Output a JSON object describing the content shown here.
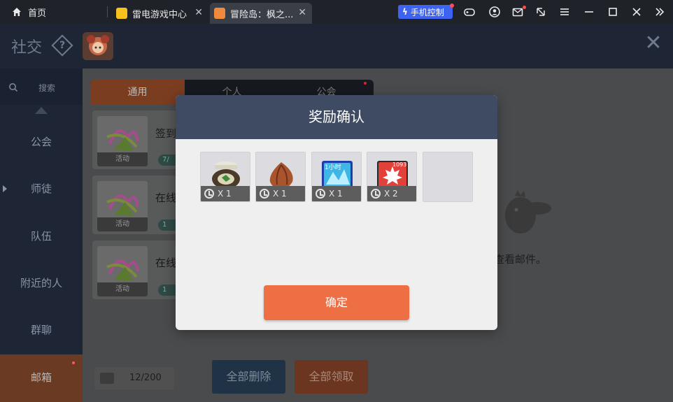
{
  "browser": {
    "home_label": "首页",
    "tabs": [
      {
        "label": "雷电游戏中心",
        "close": "✕"
      },
      {
        "label": "冒险岛：枫之...",
        "close": "✕"
      }
    ],
    "phone_control_label": "手机控制"
  },
  "header": {
    "title": "社交",
    "help_glyph": "?",
    "close_glyph": "✕"
  },
  "sidebar": {
    "search_placeholder": "搜索",
    "items": [
      {
        "label": "公会"
      },
      {
        "label": "师徒"
      },
      {
        "label": "队伍"
      },
      {
        "label": "附近的人"
      },
      {
        "label": "群聊"
      },
      {
        "label": "邮箱"
      }
    ]
  },
  "mail": {
    "tabs": [
      {
        "label": "通用"
      },
      {
        "label": "个人"
      },
      {
        "label": "公会"
      }
    ],
    "list": [
      {
        "title": "签到",
        "tag": "活动",
        "pill": "7/"
      },
      {
        "title": "在线",
        "tag": "活动",
        "pill": "1"
      },
      {
        "title": "在线",
        "tag": "活动",
        "pill": "1"
      }
    ],
    "empty_hint": "查看邮件。",
    "count": "12/200",
    "delete_all_label": "全部删除",
    "claim_all_label": "全部领取"
  },
  "modal": {
    "title": "奖励确认",
    "rewards": [
      {
        "icon": "potion-jar-icon",
        "qty": "X 1"
      },
      {
        "icon": "onion-bulb-icon",
        "qty": "X 1"
      },
      {
        "icon": "one-hour-crystal-icon",
        "qty": "X 1",
        "badge": "1小时"
      },
      {
        "icon": "maple-leaf-card-icon",
        "qty": "X 2",
        "badge": "1093"
      }
    ],
    "confirm_label": "确定"
  },
  "colors": {
    "accent": "#ef6f45",
    "modal_header": "#3f4b63",
    "phone_button": "#3d63f0",
    "notification_dot": "#ff4d4d"
  }
}
